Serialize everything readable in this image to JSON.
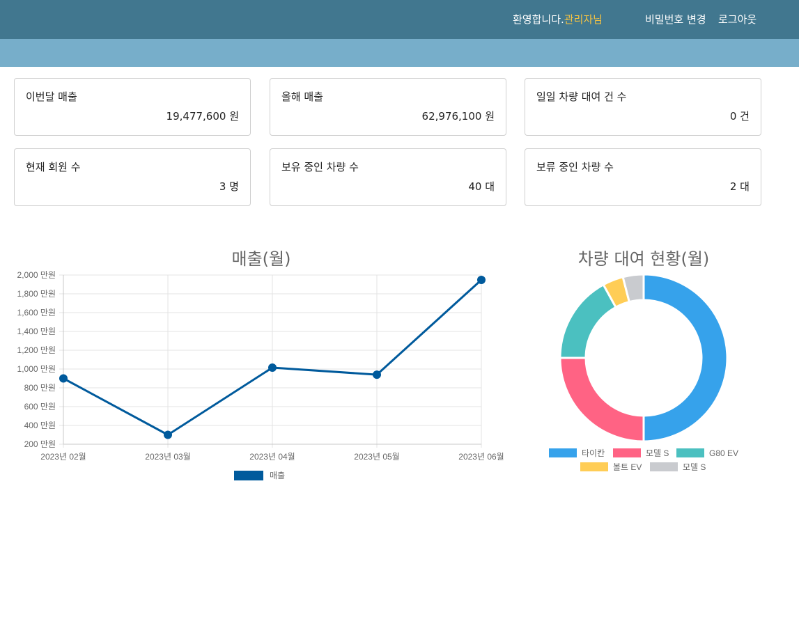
{
  "header": {
    "welcome_prefix": "환영합니다.",
    "welcome_name": "관리자님",
    "change_password": "비밀번호 변경",
    "logout": "로그아웃"
  },
  "stats": [
    {
      "label": "이번달 매출",
      "value": "19,477,600 원"
    },
    {
      "label": "올해 매출",
      "value": "62,976,100 원"
    },
    {
      "label": "일일 차량 대여 건 수",
      "value": "0 건"
    },
    {
      "label": "현재 회원 수",
      "value": "3 명"
    },
    {
      "label": "보유 중인 차량 수",
      "value": "40 대"
    },
    {
      "label": "보류 중인 차량 수",
      "value": "2 대"
    }
  ],
  "colors": {
    "header_bg": "#41778f",
    "subbar_bg": "#77aeca",
    "highlight": "#f5c342",
    "line": "#005a9c"
  },
  "chart_data": [
    {
      "type": "line",
      "title": "매출(월)",
      "categories": [
        "2023년 02월",
        "2023년 03월",
        "2023년 04월",
        "2023년 05월",
        "2023년 06월"
      ],
      "y_ticks": [
        "200 만원",
        "400 만원",
        "600 만원",
        "800 만원",
        "1,000 만원",
        "1,200 만원",
        "1,400 만원",
        "1,600 만원",
        "1,800 만원",
        "2,000 만원"
      ],
      "ylim": [
        200,
        2000
      ],
      "grid": true,
      "legend_position": "bottom",
      "series": [
        {
          "name": "매출",
          "color": "#005a9c",
          "values": [
            900,
            300,
            1015,
            940,
            1948
          ]
        }
      ]
    },
    {
      "type": "pie",
      "title": "차량 대여 현황(월)",
      "legend_position": "bottom",
      "slices": [
        {
          "label": "타이칸",
          "value": 50,
          "color": "#36a2eb"
        },
        {
          "label": "모델 S",
          "value": 25,
          "color": "#ff6384"
        },
        {
          "label": "G80 EV",
          "value": 17,
          "color": "#4bc0c0"
        },
        {
          "label": "볼트 EV",
          "value": 4,
          "color": "#ffcd56"
        },
        {
          "label": "모델 S",
          "value": 4,
          "color": "#c9cbcf"
        }
      ]
    }
  ]
}
